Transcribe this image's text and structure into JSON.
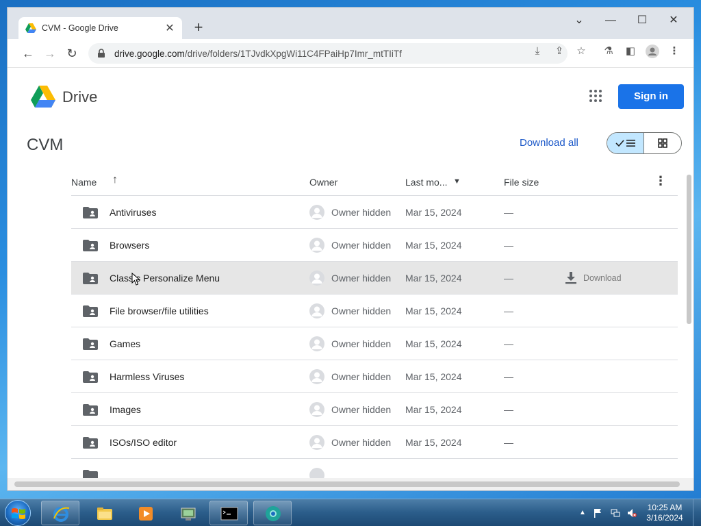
{
  "browser": {
    "tab_title": "CVM - Google Drive",
    "url_host": "drive.google.com",
    "url_path": "/drive/folders/1TJvdkXpgWi11C4FPaiHp7Imr_mtTIiTf"
  },
  "drive": {
    "product_name": "Drive",
    "sign_in_label": "Sign in",
    "folder_title": "CVM",
    "download_all_label": "Download all",
    "columns": {
      "name": "Name",
      "owner": "Owner",
      "last_modified": "Last mo...",
      "file_size": "File size"
    },
    "download_label": "Download",
    "rows": [
      {
        "name": "Antiviruses",
        "owner": "Owner hidden",
        "modified": "Mar 15, 2024",
        "size": "—"
      },
      {
        "name": "Browsers",
        "owner": "Owner hidden",
        "modified": "Mar 15, 2024",
        "size": "—"
      },
      {
        "name": "Classic Personalize Menu",
        "owner": "Owner hidden",
        "modified": "Mar 15, 2024",
        "size": "—"
      },
      {
        "name": "File browser/file utilities",
        "owner": "Owner hidden",
        "modified": "Mar 15, 2024",
        "size": "—"
      },
      {
        "name": "Games",
        "owner": "Owner hidden",
        "modified": "Mar 15, 2024",
        "size": "—"
      },
      {
        "name": "Harmless Viruses",
        "owner": "Owner hidden",
        "modified": "Mar 15, 2024",
        "size": "—"
      },
      {
        "name": "Images",
        "owner": "Owner hidden",
        "modified": "Mar 15, 2024",
        "size": "—"
      },
      {
        "name": "ISOs/ISO editor",
        "owner": "Owner hidden",
        "modified": "Mar 15, 2024",
        "size": "—"
      }
    ]
  },
  "taskbar": {
    "time": "10:25 AM",
    "date": "3/16/2024"
  },
  "colors": {
    "accent": "#1a73e8",
    "link": "#1a57c8",
    "view_toggle_active": "#c2e7ff",
    "row_hover": "#e6e6e6"
  }
}
